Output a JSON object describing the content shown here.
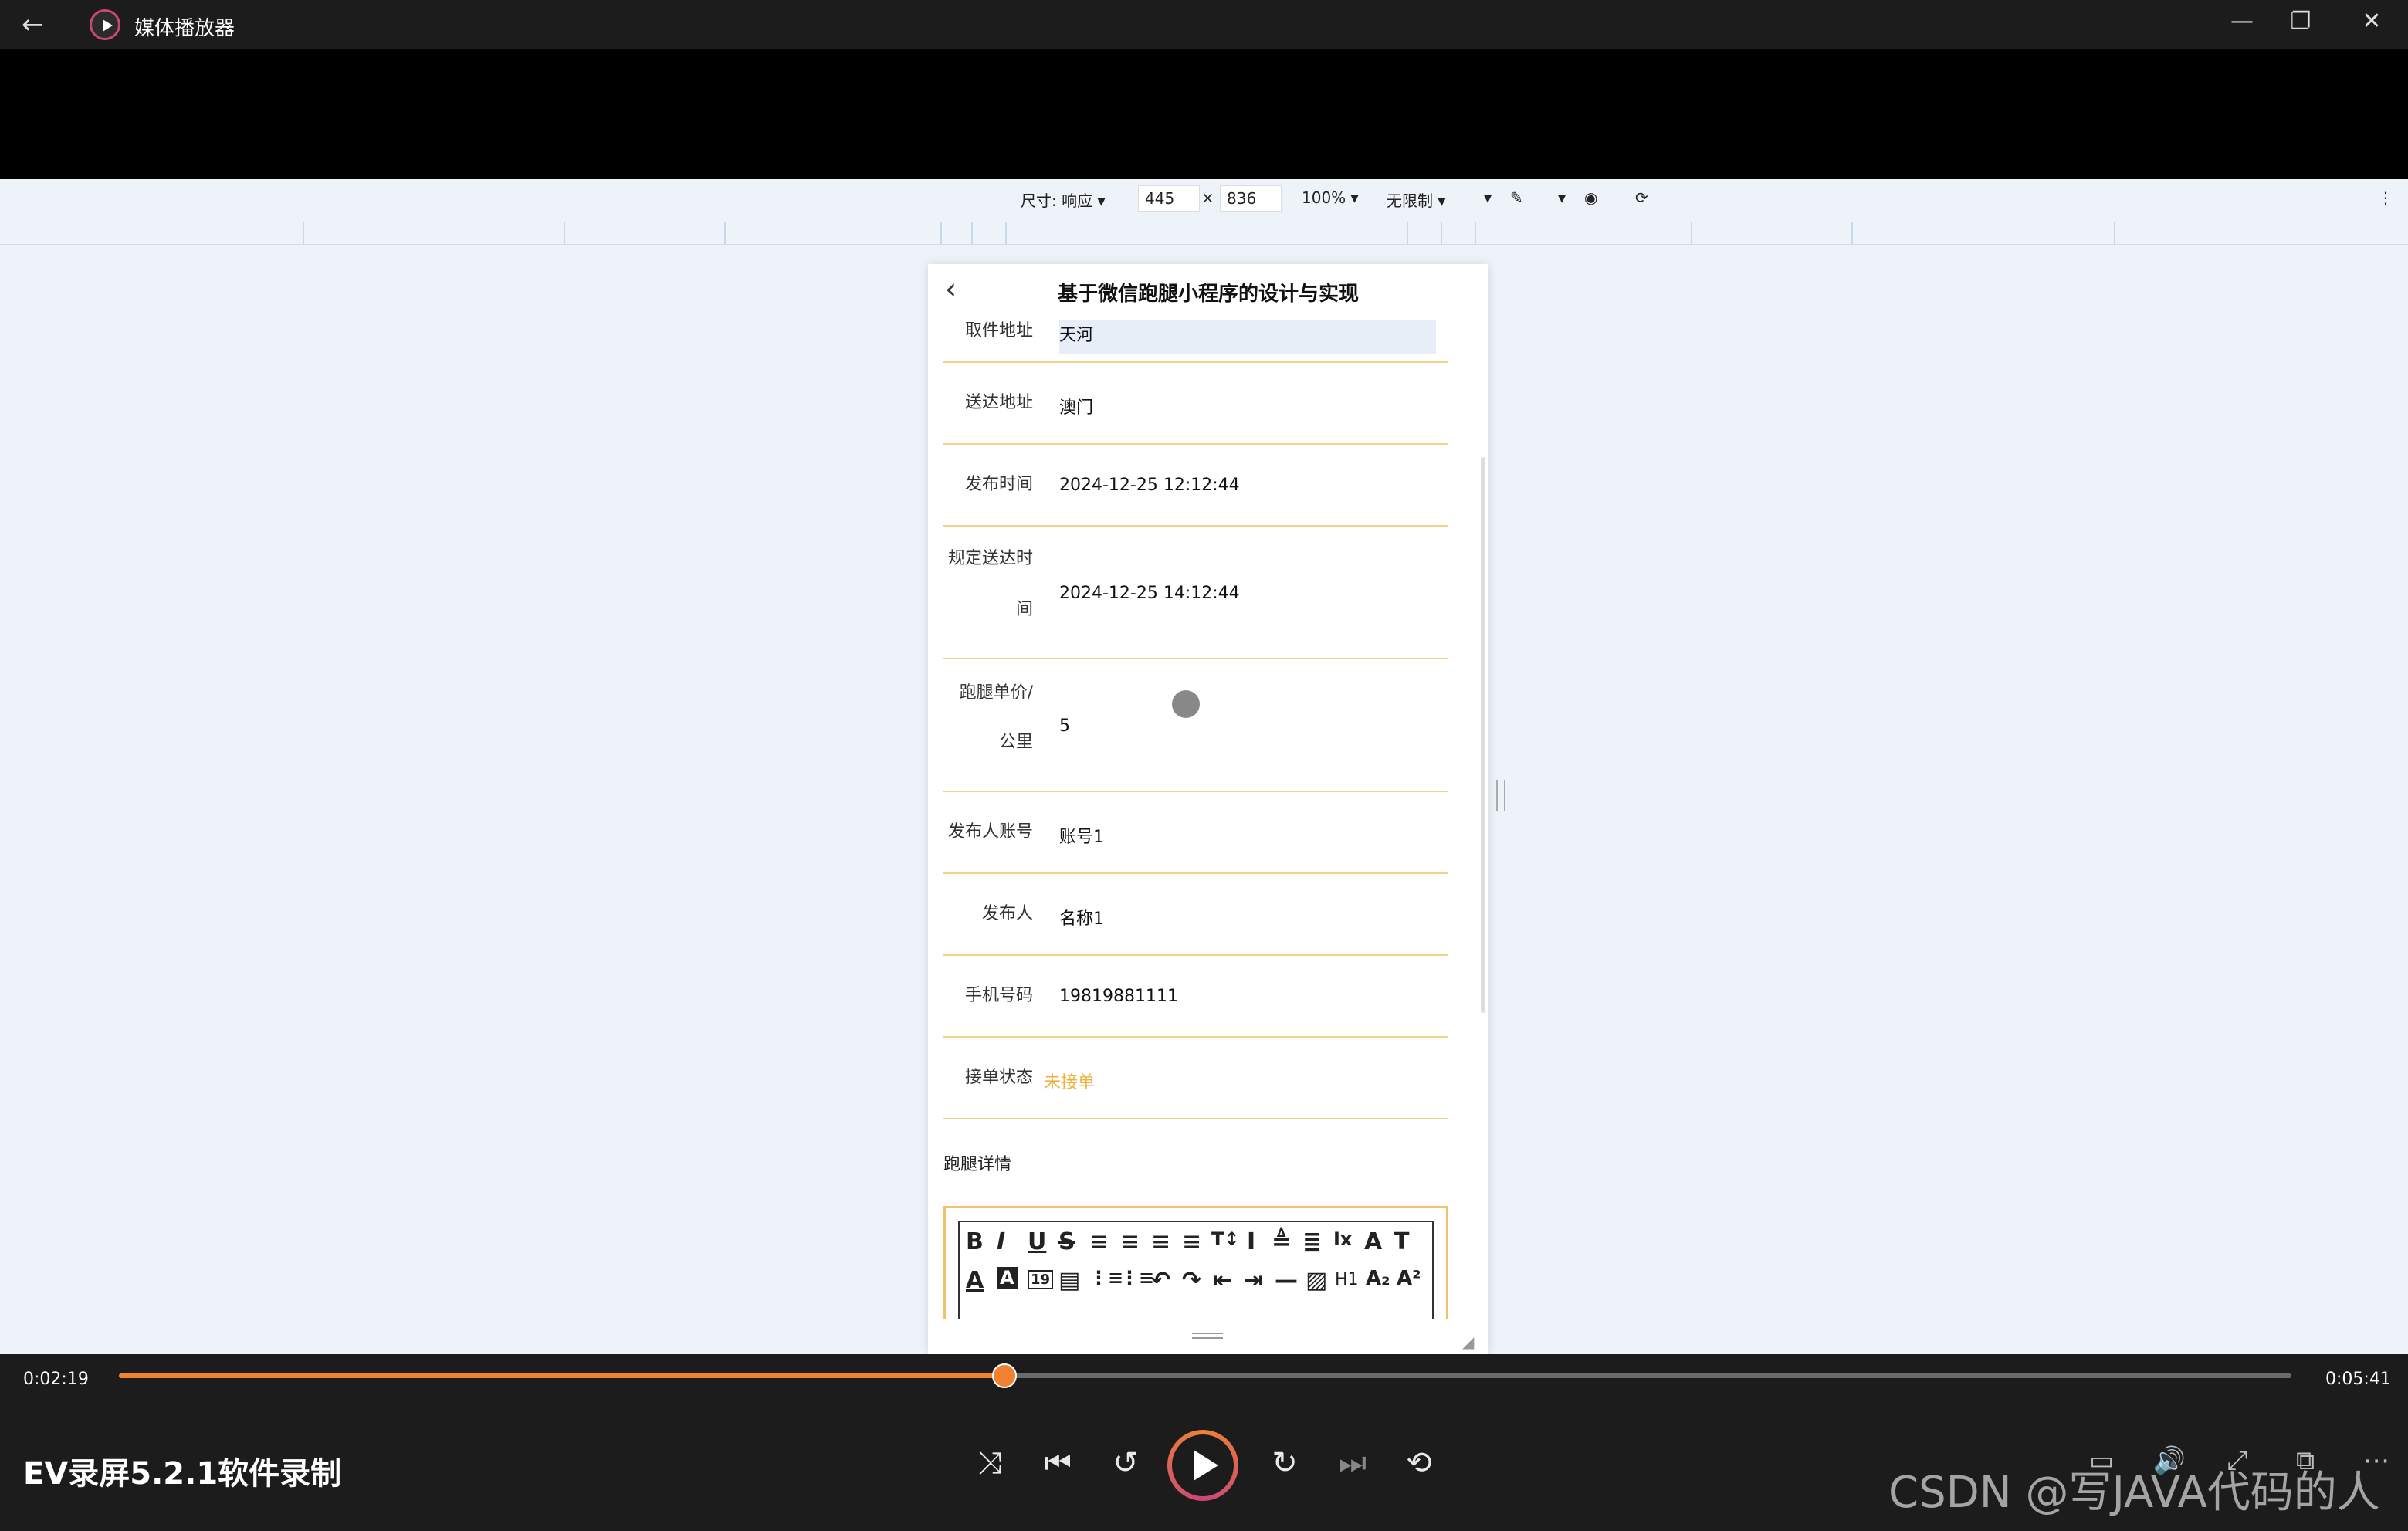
{
  "window": {
    "app_title": "媒体播放器",
    "minimize": "—",
    "maximize": "❐",
    "close": "✕",
    "back": "←"
  },
  "devtools": {
    "size_label": "尺寸: 响应",
    "width_value": "445",
    "times": "×",
    "height_value": "836",
    "zoom": "100%",
    "throttle": "无限制",
    "more": "⋮"
  },
  "phone": {
    "title": "基于微信跑腿小程序的设计与实现",
    "back": "‹",
    "rows": [
      {
        "label": "取件地址",
        "value": "天河"
      },
      {
        "label": "送达地址",
        "value": "澳门"
      },
      {
        "label": "发布时间",
        "value": "2024-12-25 12:12:44"
      },
      {
        "label_line1": "规定送达时",
        "label_line2": "间",
        "value": "2024-12-25 14:12:44"
      },
      {
        "label_line1": "跑腿单价/",
        "label_line2": "公里",
        "value": "5"
      },
      {
        "label": "发布人账号",
        "value": "账号1"
      },
      {
        "label": "发布人",
        "value": "名称1"
      },
      {
        "label": "手机号码",
        "value": "19819881111"
      },
      {
        "label": "接单状态",
        "value": "未接单"
      }
    ],
    "details_label": "跑腿详情",
    "toolbar_row1": [
      "B",
      "I",
      "U",
      "S",
      "≡",
      "≡",
      "≡",
      "≡",
      "T↕",
      "I",
      "≜",
      "≣",
      "Ix",
      "A",
      "T"
    ],
    "toolbar_row2": [
      "A",
      "A",
      "19",
      "▤",
      "⋮≡",
      "⋮≡",
      "↶",
      "↷",
      "⇤",
      "⇥",
      "—",
      "▨",
      "H1",
      "A₂",
      "A²"
    ]
  },
  "player": {
    "current_time": "0:02:19",
    "total_time": "0:05:41",
    "progress": 0.4077,
    "media_title": "EV录屏5.2.1软件录制",
    "watermark": "CSDN @写JAVA代码的人"
  }
}
